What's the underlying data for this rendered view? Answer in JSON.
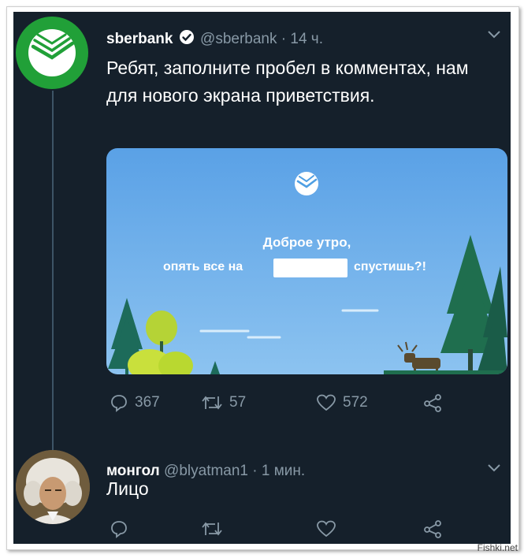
{
  "tweet": {
    "display_name": "sberbank",
    "handle": "@sberbank",
    "time": "· 14 ч.",
    "text": "Ребят, заполните пробел в комментах, нам для нового экрана приветствия.",
    "card": {
      "headline": "Доброе утро,",
      "line_prefix": "опять все на",
      "line_suffix": "спустишь?!"
    },
    "actions": {
      "replies": "367",
      "retweets": "57",
      "likes": "572"
    }
  },
  "reply": {
    "display_name": "монгол",
    "handle": "@blyatman1",
    "time": "· 1 мин.",
    "text": "Лицо"
  },
  "watermark": "Fishki.net",
  "colors": {
    "background": "#15202b",
    "muted": "#8899a6",
    "brand_green": "#21a038",
    "verified_blue": "#ffffff"
  }
}
